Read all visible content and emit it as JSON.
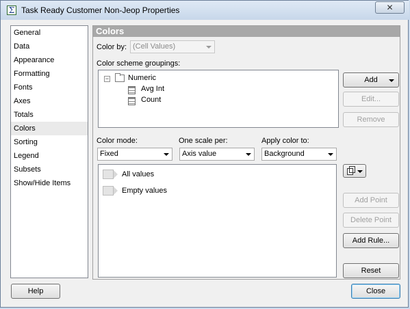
{
  "window": {
    "title": "Task Ready Customer Non-Jeop Properties",
    "close_glyph": "✕"
  },
  "nav": {
    "items": [
      {
        "label": "General"
      },
      {
        "label": "Data"
      },
      {
        "label": "Appearance"
      },
      {
        "label": "Formatting"
      },
      {
        "label": "Fonts"
      },
      {
        "label": "Axes"
      },
      {
        "label": "Totals"
      },
      {
        "label": "Colors",
        "selected": true
      },
      {
        "label": "Sorting"
      },
      {
        "label": "Legend"
      },
      {
        "label": "Subsets"
      },
      {
        "label": "Show/Hide Items"
      }
    ]
  },
  "colors": {
    "heading": "Colors",
    "color_by_label": "Color by:",
    "color_by_value": "(Cell Values)",
    "groupings_label": "Color scheme groupings:",
    "tree": {
      "toggle": "−",
      "root": "Numeric",
      "children": [
        "Avg Int",
        "Count"
      ]
    },
    "add_button": "Add",
    "edit_button": "Edit...",
    "remove_button": "Remove",
    "color_mode_label": "Color mode:",
    "color_mode_value": "Fixed",
    "one_scale_label": "One scale per:",
    "one_scale_value": "Axis value",
    "apply_color_label": "Apply color to:",
    "apply_color_value": "Background",
    "rules": [
      "All values",
      "Empty values"
    ],
    "add_point_button": "Add Point",
    "delete_point_button": "Delete Point",
    "add_rule_button": "Add Rule...",
    "reset_button": "Reset"
  },
  "footer": {
    "help_button": "Help",
    "close_button": "Close"
  }
}
